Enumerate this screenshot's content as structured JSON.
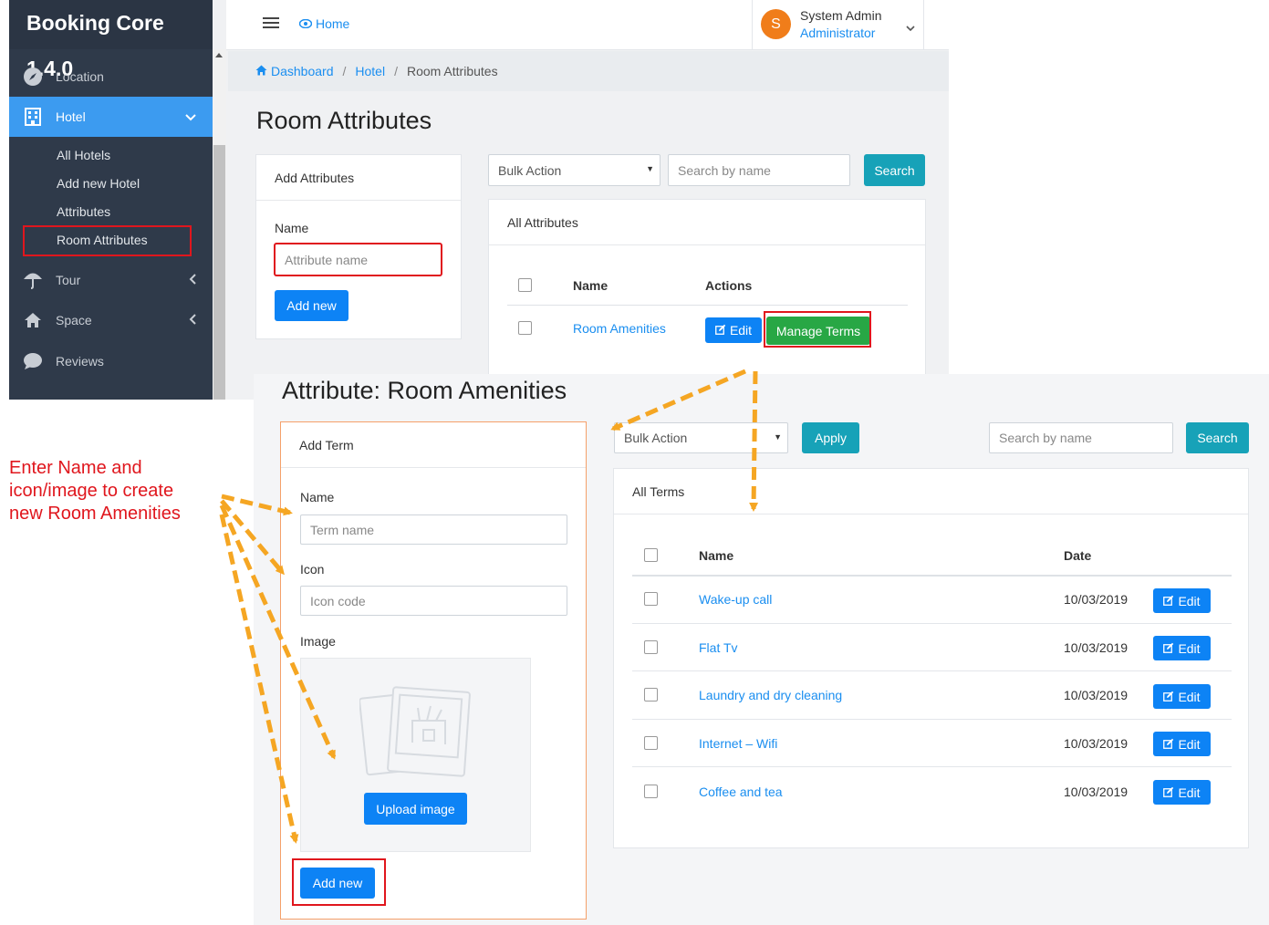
{
  "app": {
    "brand": "Booking Core 1.4.0"
  },
  "sidebar": {
    "items": [
      {
        "label": "Location",
        "icon": "compass-icon"
      },
      {
        "label": "Hotel",
        "icon": "building-icon"
      },
      {
        "label": "Tour",
        "icon": "umbrella-icon"
      },
      {
        "label": "Space",
        "icon": "home-icon"
      },
      {
        "label": "Reviews",
        "icon": "comment-icon"
      }
    ],
    "hotel_submenu": [
      "All Hotels",
      "Add new Hotel",
      "Attributes",
      "Room Attributes"
    ]
  },
  "topbar": {
    "home_label": "Home",
    "user_initial": "S",
    "user_name": "System Admin",
    "user_role": "Administrator"
  },
  "breadcrumb": {
    "items": [
      "Dashboard",
      "Hotel",
      "Room Attributes"
    ],
    "separator": "/"
  },
  "page1": {
    "title": "Room Attributes",
    "add_card_title": "Add Attributes",
    "name_label": "Name",
    "name_placeholder": "Attribute name",
    "add_button": "Add new",
    "bulk_action": "Bulk Action",
    "search_placeholder": "Search by name",
    "search_button": "Search",
    "list_title": "All Attributes",
    "columns": [
      "Name",
      "Actions"
    ],
    "rows": [
      {
        "name": "Room Amenities",
        "edit": "Edit",
        "manage": "Manage Terms"
      }
    ]
  },
  "page2": {
    "title": "Attribute: Room Amenities",
    "add_card_title": "Add Term",
    "name_label": "Name",
    "name_placeholder": "Term name",
    "icon_label": "Icon",
    "icon_placeholder": "Icon code",
    "image_label": "Image",
    "upload_button": "Upload image",
    "add_button": "Add new",
    "bulk_action": "Bulk Action",
    "apply_button": "Apply",
    "search_placeholder": "Search by name",
    "search_button": "Search",
    "list_title": "All Terms",
    "columns": [
      "Name",
      "Date"
    ],
    "rows": [
      {
        "name": "Wake-up call",
        "date": "10/03/2019",
        "edit": "Edit"
      },
      {
        "name": "Flat Tv",
        "date": "10/03/2019",
        "edit": "Edit"
      },
      {
        "name": "Laundry and dry cleaning",
        "date": "10/03/2019",
        "edit": "Edit"
      },
      {
        "name": "Internet – Wifi",
        "date": "10/03/2019",
        "edit": "Edit"
      },
      {
        "name": "Coffee and tea",
        "date": "10/03/2019",
        "edit": "Edit"
      }
    ]
  },
  "annotation": {
    "note": "Enter Name and icon/image to create new Room Amenities",
    "note_lines": [
      "Enter Name and",
      "icon/image to create",
      "new Room Amenities"
    ],
    "note_color": "#e0161d",
    "arrow_color": "#f5a623"
  }
}
